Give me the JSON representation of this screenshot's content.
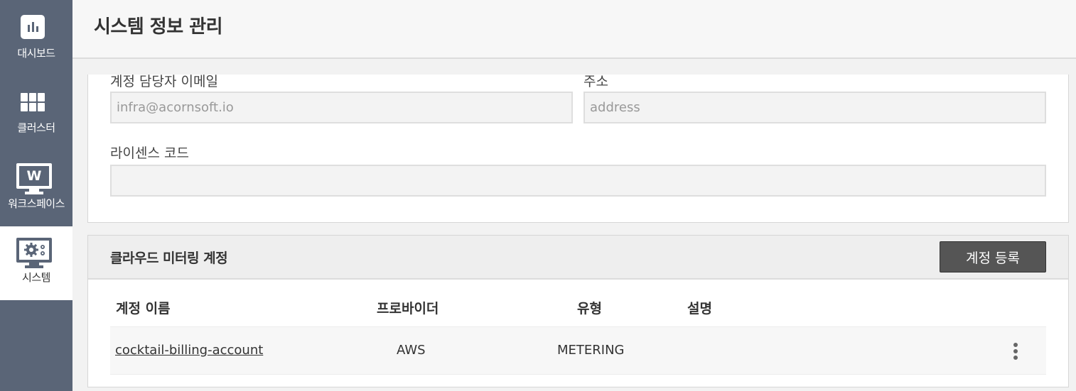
{
  "sidebar": {
    "items": [
      {
        "label": "대시보드",
        "icon": "dashboard-icon"
      },
      {
        "label": "클러스터",
        "icon": "grid-icon"
      },
      {
        "label": "워크스페이스",
        "icon": "workspace-monitor-icon",
        "glyph": "W"
      },
      {
        "label": "시스템",
        "icon": "system-monitor-gear-icon",
        "active": true
      }
    ]
  },
  "header": {
    "title": "시스템 정보 관리"
  },
  "form": {
    "email_label": "계정 담당자 이메일",
    "email_value": "infra@acornsoft.io",
    "address_label": "주소",
    "address_placeholder": "address",
    "license_label": "라이센스 코드",
    "license_value": ""
  },
  "cloud_metering": {
    "title": "클라우드 미터링 계정",
    "register_button": "계정 등록",
    "columns": {
      "name": "계정 이름",
      "provider": "프로바이더",
      "type": "유형",
      "description": "설명"
    },
    "rows": [
      {
        "name": "cocktail-billing-account",
        "provider": "AWS",
        "type": "METERING",
        "description": ""
      }
    ]
  },
  "colors": {
    "sidebar_bg": "#5a6577",
    "button_bg": "#555555"
  }
}
